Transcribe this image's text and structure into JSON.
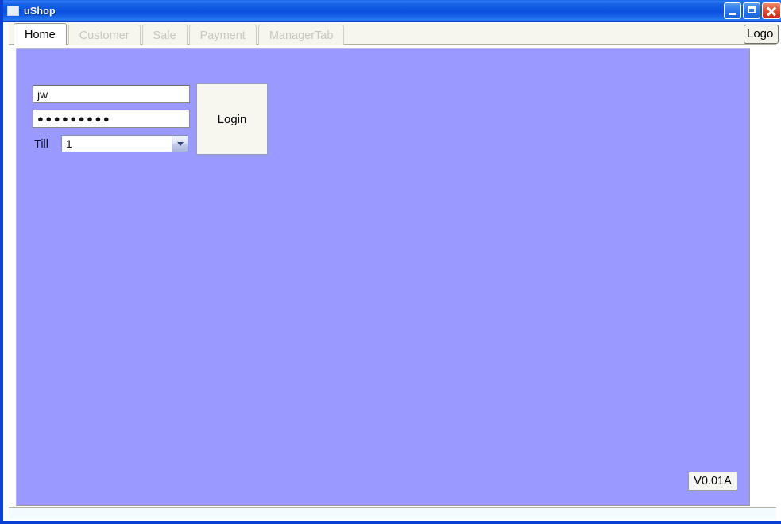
{
  "window": {
    "title": "uShop",
    "icon": "application-icon",
    "controls": {
      "minimize": "Minimize",
      "maximize": "Maximize",
      "close": "Close"
    }
  },
  "tabs": [
    {
      "label": "Home",
      "active": true
    },
    {
      "label": "Customer",
      "active": false
    },
    {
      "label": "Sale",
      "active": false
    },
    {
      "label": "Payment",
      "active": false
    },
    {
      "label": "ManagerTab",
      "active": false
    }
  ],
  "logo": {
    "label": "Logo"
  },
  "login_form": {
    "username": {
      "value": "jw",
      "placeholder": ""
    },
    "password": {
      "value": "●●●●●●●●●",
      "placeholder": ""
    },
    "till": {
      "label": "Till",
      "selected": "1",
      "options": [
        "1"
      ]
    },
    "login_button": "Login"
  },
  "footer": {
    "version": "V0.01A"
  },
  "colors": {
    "panel_background": "#9999ff",
    "titlebar_blue": "#0c55e0",
    "window_border": "#0a3fd4",
    "close_button": "#c32a14",
    "active_tab_text": "#000000",
    "inactive_tab_text": "#c8c8c0"
  }
}
